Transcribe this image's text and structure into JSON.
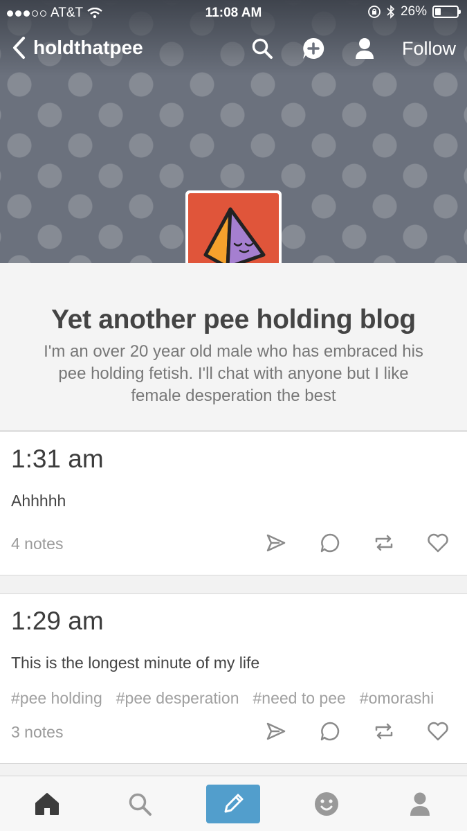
{
  "status_bar": {
    "carrier": "AT&T",
    "time": "11:08 AM",
    "battery": "26%",
    "battery_level": 0.26
  },
  "nav": {
    "blog_name": "holdthatpee",
    "follow_label": "Follow",
    "icons": [
      "back-chevron-icon",
      "search-icon",
      "new-message-icon",
      "profile-icon"
    ]
  },
  "blog": {
    "title": "Yet another pee holding blog",
    "description": "I'm an over 20 year old male who has embraced his pee holding fetish. I'll chat with anyone but I like female desperation the best",
    "avatar_colors": {
      "background": "#e0553a",
      "left_face": "#f5a12c",
      "right_face": "#a57fd0"
    }
  },
  "posts": [
    {
      "time": "1:31 am",
      "body": "Ahhhhh",
      "tags": [],
      "notes": "4 notes"
    },
    {
      "time": "1:29 am",
      "body": "This is the longest minute of my life",
      "tags": [
        "#pee holding",
        "#pee desperation",
        "#need to pee",
        "#omorashi"
      ],
      "notes": "3 notes"
    }
  ],
  "post_action_icons": [
    "send-icon",
    "reply-icon",
    "reblog-icon",
    "like-heart-icon"
  ],
  "tab_bar": {
    "tabs": [
      "home-icon",
      "search-icon",
      "compose-pencil-icon",
      "activity-face-icon",
      "account-icon"
    ],
    "accent": "#529ecc"
  }
}
